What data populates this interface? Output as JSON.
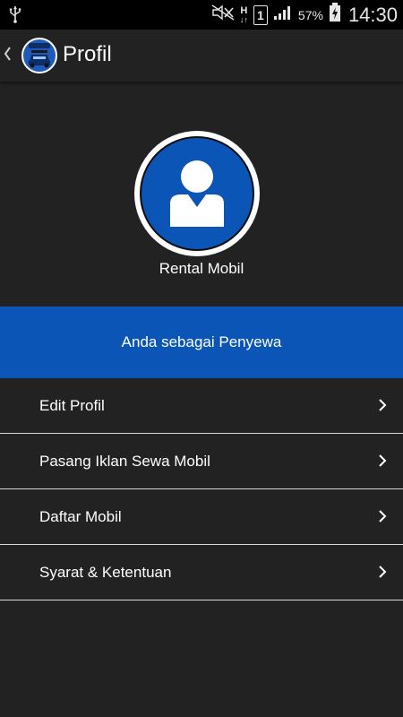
{
  "status_bar": {
    "battery_percent": "57%",
    "time": "14:30",
    "sim_slot": "1",
    "network": "H"
  },
  "header": {
    "title": "Profil",
    "back_icon": "chevron-left-icon",
    "logo_icon": "car-logo-icon"
  },
  "profile": {
    "name": "Rental Mobil",
    "avatar_icon": "user-avatar-icon",
    "role_text": "Anda sebagai Penyewa"
  },
  "menu": {
    "items": [
      {
        "label": "Edit Profil",
        "icon": "chevron-right-icon"
      },
      {
        "label": "Pasang Iklan Sewa Mobil",
        "icon": "chevron-right-icon"
      },
      {
        "label": "Daftar Mobil",
        "icon": "chevron-right-icon"
      },
      {
        "label": "Syarat & Ketentuan",
        "icon": "chevron-right-icon"
      }
    ]
  },
  "colors": {
    "accent": "#0a55b5",
    "background": "#222222",
    "statusbar": "#000000"
  }
}
